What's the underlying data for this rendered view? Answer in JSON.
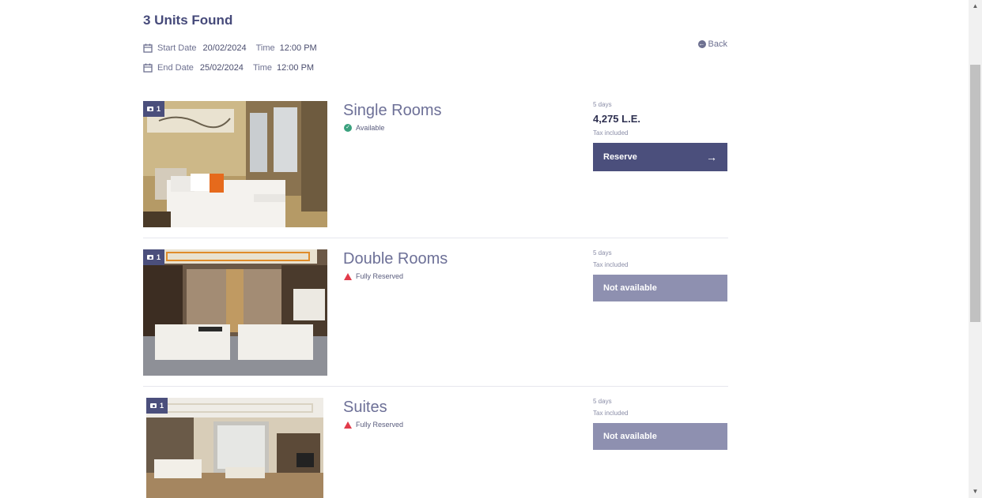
{
  "header": {
    "title": "3 Units Found",
    "back_label": "Back"
  },
  "dates": {
    "start_label": "Start Date",
    "start_value": "20/02/2024",
    "start_time_label": "Time",
    "start_time_value": "12:00 PM",
    "end_label": "End Date",
    "end_value": "25/02/2024",
    "end_time_label": "Time",
    "end_time_value": "12:00 PM"
  },
  "units": [
    {
      "name": "Single Rooms",
      "photo_count": "1",
      "status": "Available",
      "status_icon": "check-circle-icon",
      "days": "5 days",
      "price": "4,275 L.E.",
      "tax": "Tax included",
      "button_label": "Reserve"
    },
    {
      "name": "Double Rooms",
      "photo_count": "1",
      "status": "Fully Reserved",
      "status_icon": "warning-icon",
      "days": "5 days",
      "tax": "Tax included",
      "button_label": "Not available"
    },
    {
      "name": "Suites",
      "photo_count": "1",
      "status": "Fully Reserved",
      "status_icon": "warning-icon",
      "days": "5 days",
      "tax": "Tax included",
      "button_label": "Not available"
    }
  ],
  "colors": {
    "primary": "#4b4f7c",
    "disabled": "#8e90b0",
    "available": "#3aa17e",
    "reserved": "#e23b4a"
  }
}
